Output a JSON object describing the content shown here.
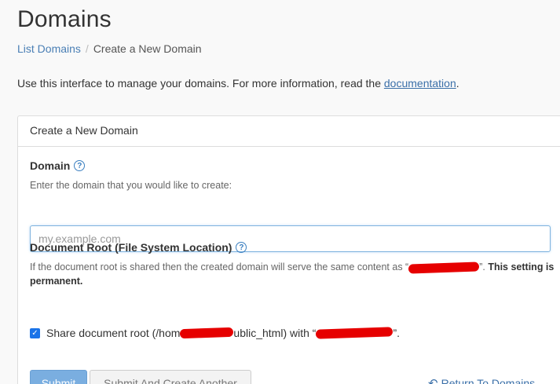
{
  "header": {
    "title": "Domains"
  },
  "breadcrumb": {
    "parent": "List Domains",
    "separator": "/",
    "current": "Create a New Domain"
  },
  "intro": {
    "text": "Use this interface to manage your domains. For more information, read the ",
    "link": "documentation",
    "end": "."
  },
  "panel": {
    "heading": "Create a New Domain",
    "domain": {
      "label": "Domain",
      "help": "Enter the domain that you would like to create:",
      "placeholder": "my.example.com",
      "value": ""
    },
    "doc_root": {
      "label": "Document Root (File System Location)",
      "help_prefix": "If the document root is shared then the created domain will serve the same content as “",
      "help_mid": "”. ",
      "help_bold": "This setting is permanent.",
      "checkbox_checked": true,
      "checkbox_prefix": "Share document root (/hom",
      "checkbox_mid": "ublic_html) with “",
      "checkbox_suffix": "”."
    },
    "buttons": {
      "submit": "Submit",
      "submit_another": "Submit And Create Another",
      "return": "Return To Domains"
    }
  },
  "icons": {
    "help": "question-circle-icon",
    "checkbox": "checkmark-icon",
    "return": "undo-arrow-icon"
  },
  "colors": {
    "link": "#3a6fa8",
    "primary_button": "#7aaee0",
    "redaction": "#e60000"
  }
}
